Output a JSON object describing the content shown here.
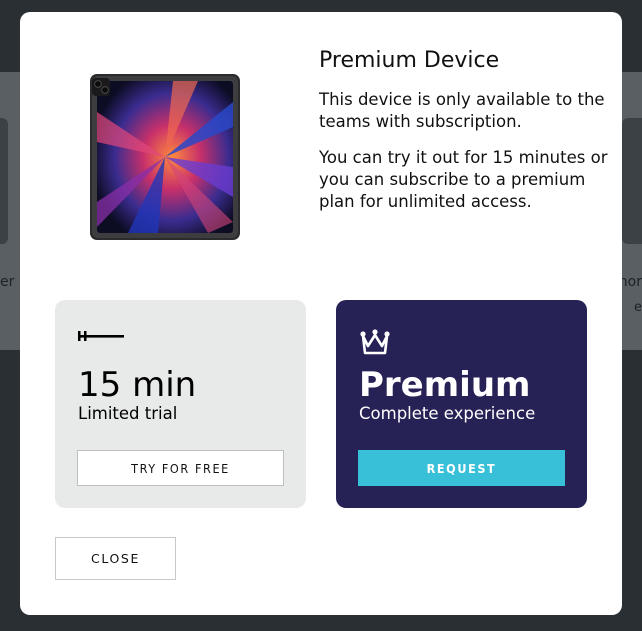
{
  "background": {
    "left_text": "er",
    "right_text": "nor",
    "right_text2": "e"
  },
  "modal": {
    "title": "Premium Device",
    "description_1": "This device is only available to the teams with subscription.",
    "description_2": "You can try it out for 15 minutes or you can subscribe to a premium plan for unlimited access.",
    "device_image": "tablet-device-image"
  },
  "plans": {
    "trial": {
      "icon": "timer-bar-icon",
      "title": "15 min",
      "subtitle": "Limited trial",
      "button_label": "TRY FOR FREE"
    },
    "premium": {
      "icon": "crown-icon",
      "title": "Premium",
      "subtitle": "Complete experience",
      "button_label": "REQUEST"
    }
  },
  "close_label": "CLOSE",
  "colors": {
    "premium_bg": "#262255",
    "request_button": "#37c0d8",
    "trial_bg": "#e8e9e9"
  }
}
